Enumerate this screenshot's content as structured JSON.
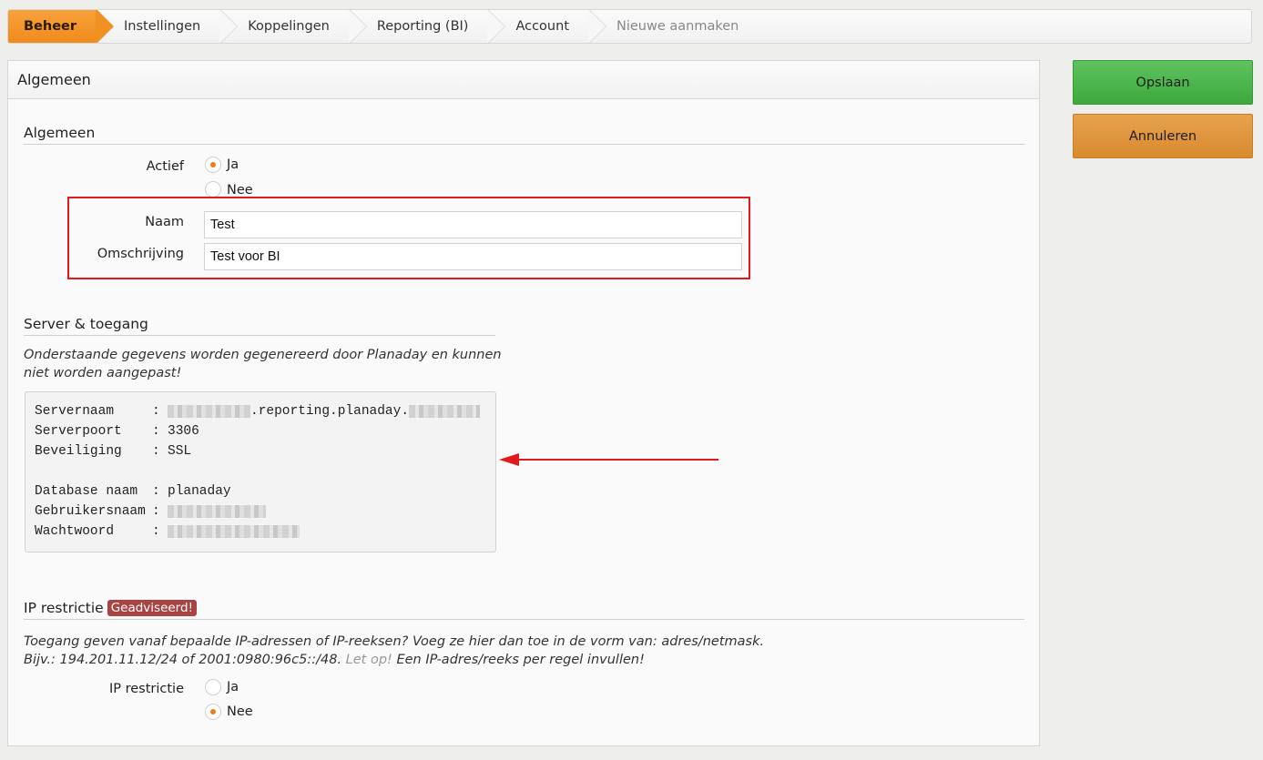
{
  "breadcrumb": {
    "items": [
      {
        "label": "Beheer"
      },
      {
        "label": "Instellingen"
      },
      {
        "label": "Koppelingen"
      },
      {
        "label": "Reporting (BI)"
      },
      {
        "label": "Account"
      },
      {
        "label": "Nieuwe aanmaken"
      }
    ]
  },
  "panel": {
    "title": "Algemeen",
    "general": {
      "title": "Algemeen",
      "active_label": "Actief",
      "options": {
        "yes": "Ja",
        "no": "Nee"
      },
      "active_value": "Ja",
      "name_label": "Naam",
      "name_value": "Test",
      "description_label": "Omschrijving",
      "description_value": "Test voor BI"
    },
    "server": {
      "title": "Server & toegang",
      "note": "Onderstaande gegevens worden gegenereerd door Planaday en kunnen niet worden aangepast!",
      "rows": {
        "servername_key": "Servernaam",
        "servername_visible": ".reporting.planaday.",
        "serverport_key": "Serverpoort",
        "serverport_value": "3306",
        "security_key": "Beveiliging",
        "security_value": "SSL",
        "database_key": "Database naam",
        "database_value": "planaday",
        "username_key": "Gebruikersnaam",
        "password_key": "Wachtwoord",
        "separator": ":"
      }
    },
    "ip": {
      "title": "IP restrictie",
      "badge": "Geadviseerd!",
      "note_line1": "Toegang geven vanaf bepaalde IP-adressen of IP-reeksen? Voeg ze hier dan toe in de vorm van: adres/netmask.",
      "note_line2_start": "Bijv.: 194.201.11.12/24 of 2001:0980:96c5::/48.",
      "note_line2_warn": "Let op!",
      "note_line2_end": "Een IP-adres/reeks per regel invullen!",
      "restriction_label": "IP restrictie",
      "options": {
        "yes": "Ja",
        "no": "Nee"
      },
      "restriction_value": "Nee"
    }
  },
  "buttons": {
    "save": "Opslaan",
    "cancel": "Annuleren"
  },
  "colors": {
    "accent_orange": "#f08a1c",
    "save_green": "#4cb54c",
    "cancel_orange": "#e0953e",
    "highlight_red": "#e01b1b",
    "badge_red": "#a94442"
  }
}
